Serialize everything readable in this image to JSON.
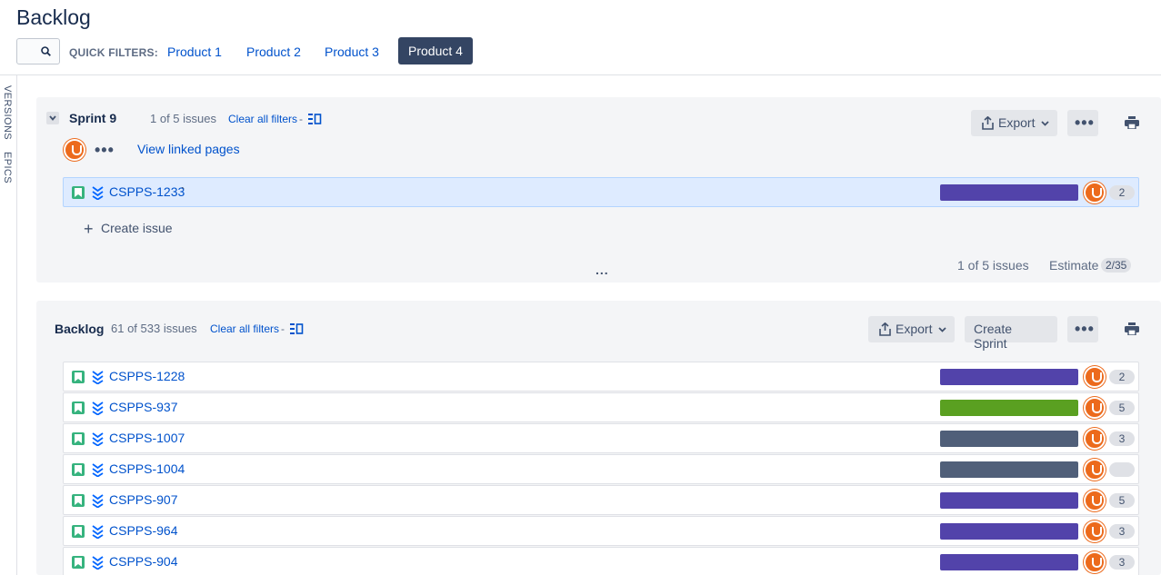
{
  "page": {
    "title": "Backlog"
  },
  "quick_filters": {
    "label": "QUICK FILTERS:",
    "items": [
      "Product 1",
      "Product 2",
      "Product 3",
      "Product 4"
    ],
    "active": "Product 4"
  },
  "rail": {
    "tabs": [
      "VERSIONS",
      "EPICS"
    ]
  },
  "sprint": {
    "name": "Sprint 9",
    "issue_count": "1 of 5 issues",
    "clear_filters": "Clear all filters",
    "separator": "-",
    "view_linked_pages": "View linked pages",
    "export_label": "Export",
    "create_issue": "Create issue",
    "more": "...",
    "footer_issues": "1 of 5 issues",
    "estimate_label": "Estimate",
    "estimate_value": "2/35",
    "issues": [
      {
        "key": "CSPPS-1233",
        "suffix": "`",
        "epic_color": "#5243aa",
        "points": "2"
      }
    ]
  },
  "backlog": {
    "title": "Backlog",
    "issue_count": "61 of 533 issues",
    "clear_filters": "Clear all filters",
    "separator": "-",
    "export_label": "Export",
    "create_sprint": "Create Sprint",
    "issues": [
      {
        "key": "CSPPS-1228",
        "epic_color": "#5243aa",
        "points": "2"
      },
      {
        "key": "CSPPS-937",
        "epic_color": "#5aa021",
        "points": "5"
      },
      {
        "key": "CSPPS-1007",
        "epic_color": "#505f79",
        "points": "3"
      },
      {
        "key": "CSPPS-1004",
        "epic_color": "#505f79",
        "points": ""
      },
      {
        "key": "CSPPS-907",
        "epic_color": "#5243aa",
        "points": "5"
      },
      {
        "key": "CSPPS-964",
        "epic_color": "#5243aa",
        "points": "3"
      },
      {
        "key": "CSPPS-904",
        "epic_color": "#5243aa",
        "points": "3"
      }
    ]
  },
  "icons": [
    "search-icon",
    "chevron-down-icon",
    "board-icon",
    "export-icon",
    "more-icon",
    "print-icon",
    "story-icon",
    "priority-lowest-icon",
    "plus-icon",
    "avatar"
  ],
  "colors": {
    "accent": "#0052cc",
    "active_filter": "#344563",
    "panel_bg": "#f4f5f7",
    "avatar": "#ec6a1c",
    "story": "#36b37e"
  }
}
